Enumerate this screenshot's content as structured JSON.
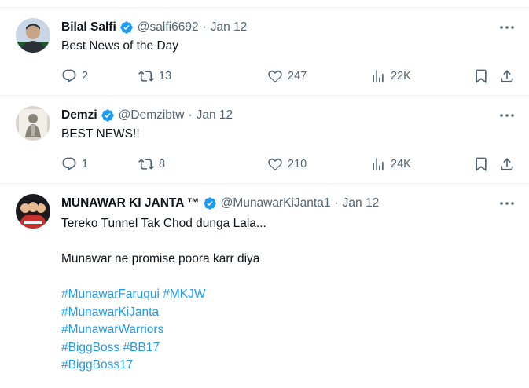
{
  "tweets": [
    {
      "name": "Bilal Salfi",
      "handle": "@salfi6692",
      "separator": "·",
      "date": "Jan 12",
      "text": "Best News of the Day",
      "replies": "2",
      "retweets": "13",
      "likes": "247",
      "views": "22K",
      "avatar_colors": [
        "#c9d6e6",
        "#2b2f36",
        "#1a5a2a"
      ]
    },
    {
      "name": "Demzi",
      "handle": "@Demzibtw",
      "separator": "·",
      "date": "Jan 12",
      "text": "BEST NEWS!!",
      "replies": "1",
      "retweets": "8",
      "likes": "210",
      "views": "24K",
      "avatar_colors": [
        "#d8d4cc",
        "#8a8378",
        "#f2efe9"
      ]
    },
    {
      "name": "MUNAWAR KI JANTA ™",
      "handle": "@MunawarKiJanta1",
      "separator": "·",
      "date": "Jan 12",
      "lines": [
        "Tereko Tunnel Tak Chod dunga Lala...",
        "Munawar ne promise poora karr diya"
      ],
      "hashtags": [
        "#MunawarFaruqui #MKJW",
        "#MunawarKiJanta",
        "#MunawarWarriors",
        "#BiggBoss #BB17",
        "#BiggBoss17"
      ],
      "avatar_colors": [
        "#1b1b1f",
        "#c8322e",
        "#e9b98f"
      ]
    }
  ],
  "icons": {
    "verified": "verified-badge-icon",
    "more": "more-options-icon",
    "reply": "reply-icon",
    "retweet": "retweet-icon",
    "like": "like-icon",
    "views": "views-icon",
    "bookmark": "bookmark-icon",
    "share": "share-icon"
  },
  "colors": {
    "verified": "#1d9bf0",
    "hashtag": "#1d9bf0",
    "secondary_text": "#536471",
    "primary_text": "#0f1419",
    "divider": "#eff3f4"
  }
}
